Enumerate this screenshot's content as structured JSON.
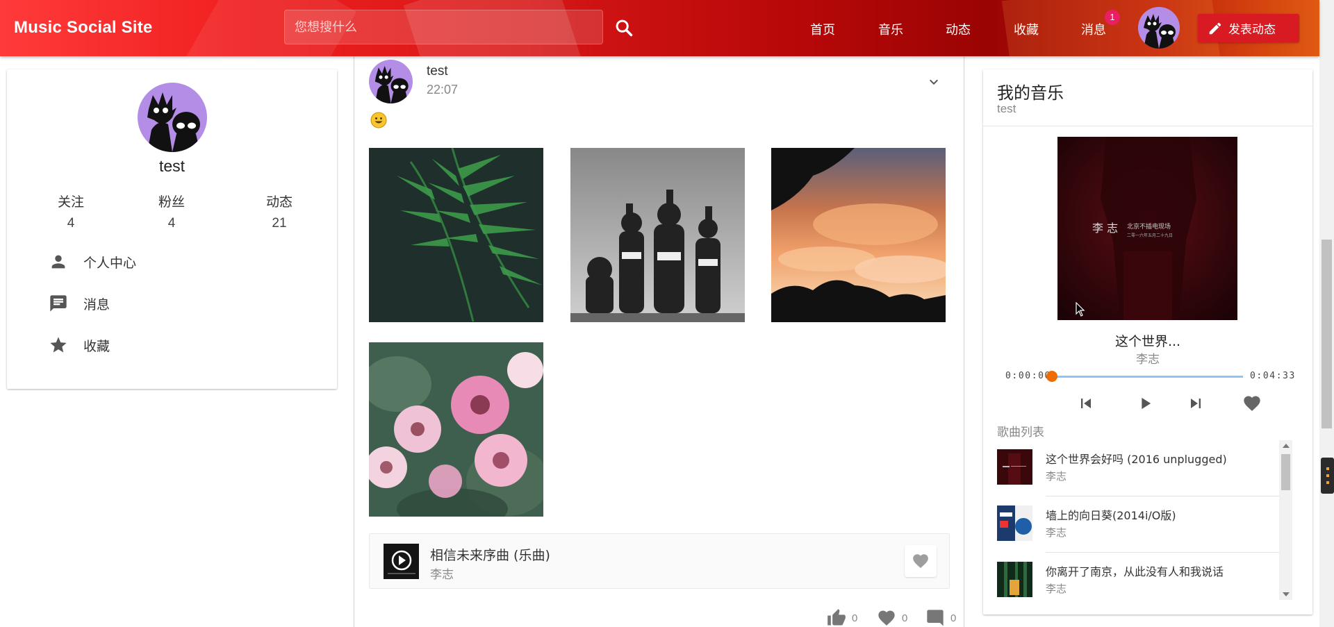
{
  "header": {
    "brand": "Music Social Site",
    "search_placeholder": "您想搜什么",
    "nav": [
      "首页",
      "音乐",
      "动态",
      "收藏",
      "消息"
    ],
    "message_badge": "1",
    "post_button_label": "发表动态",
    "colors": {
      "primary": "#d81b22",
      "badge": "#e91e63"
    }
  },
  "profile": {
    "name": "test",
    "stats": [
      {
        "label": "关注",
        "value": "4"
      },
      {
        "label": "粉丝",
        "value": "4"
      },
      {
        "label": "动态",
        "value": "21"
      }
    ],
    "menu": [
      {
        "label": "个人中心",
        "icon": "person-icon"
      },
      {
        "label": "消息",
        "icon": "message-icon"
      },
      {
        "label": "收藏",
        "icon": "star-icon"
      }
    ]
  },
  "post": {
    "user": "test",
    "time": "22:07",
    "emoji": "😀",
    "photos": [
      "fern-leaves-photo",
      "cartoon-group-photo",
      "sunset-clouds-photo",
      "pink-roses-photo"
    ],
    "song": {
      "title": "相信未来序曲 (乐曲)",
      "artist": "李志"
    },
    "actions": {
      "likes": "0",
      "favorites": "0",
      "comments": "0"
    }
  },
  "music": {
    "title": "我的音乐",
    "subtitle": "test",
    "album_text": "李 志",
    "album_caption": "北京不插电现场",
    "album_caption_small": "二零一六年五月二十九日",
    "now_playing": {
      "title": "这个世界...",
      "artist": "李志"
    },
    "time_current": "0:00:00",
    "time_total": "0:04:33",
    "progress_fraction": 0.0,
    "playlist_label": "歌曲列表",
    "playlist": [
      {
        "title": "这个世界会好吗 (2016 unplugged)",
        "artist": "李志"
      },
      {
        "title": "墙上的向日葵(2014i/O版)",
        "artist": "李志"
      },
      {
        "title": "你离开了南京，从此没有人和我说话",
        "artist": "李志"
      }
    ],
    "colors": {
      "progress_track": "#90c4f4",
      "progress_knob": "#ef6c00"
    }
  }
}
